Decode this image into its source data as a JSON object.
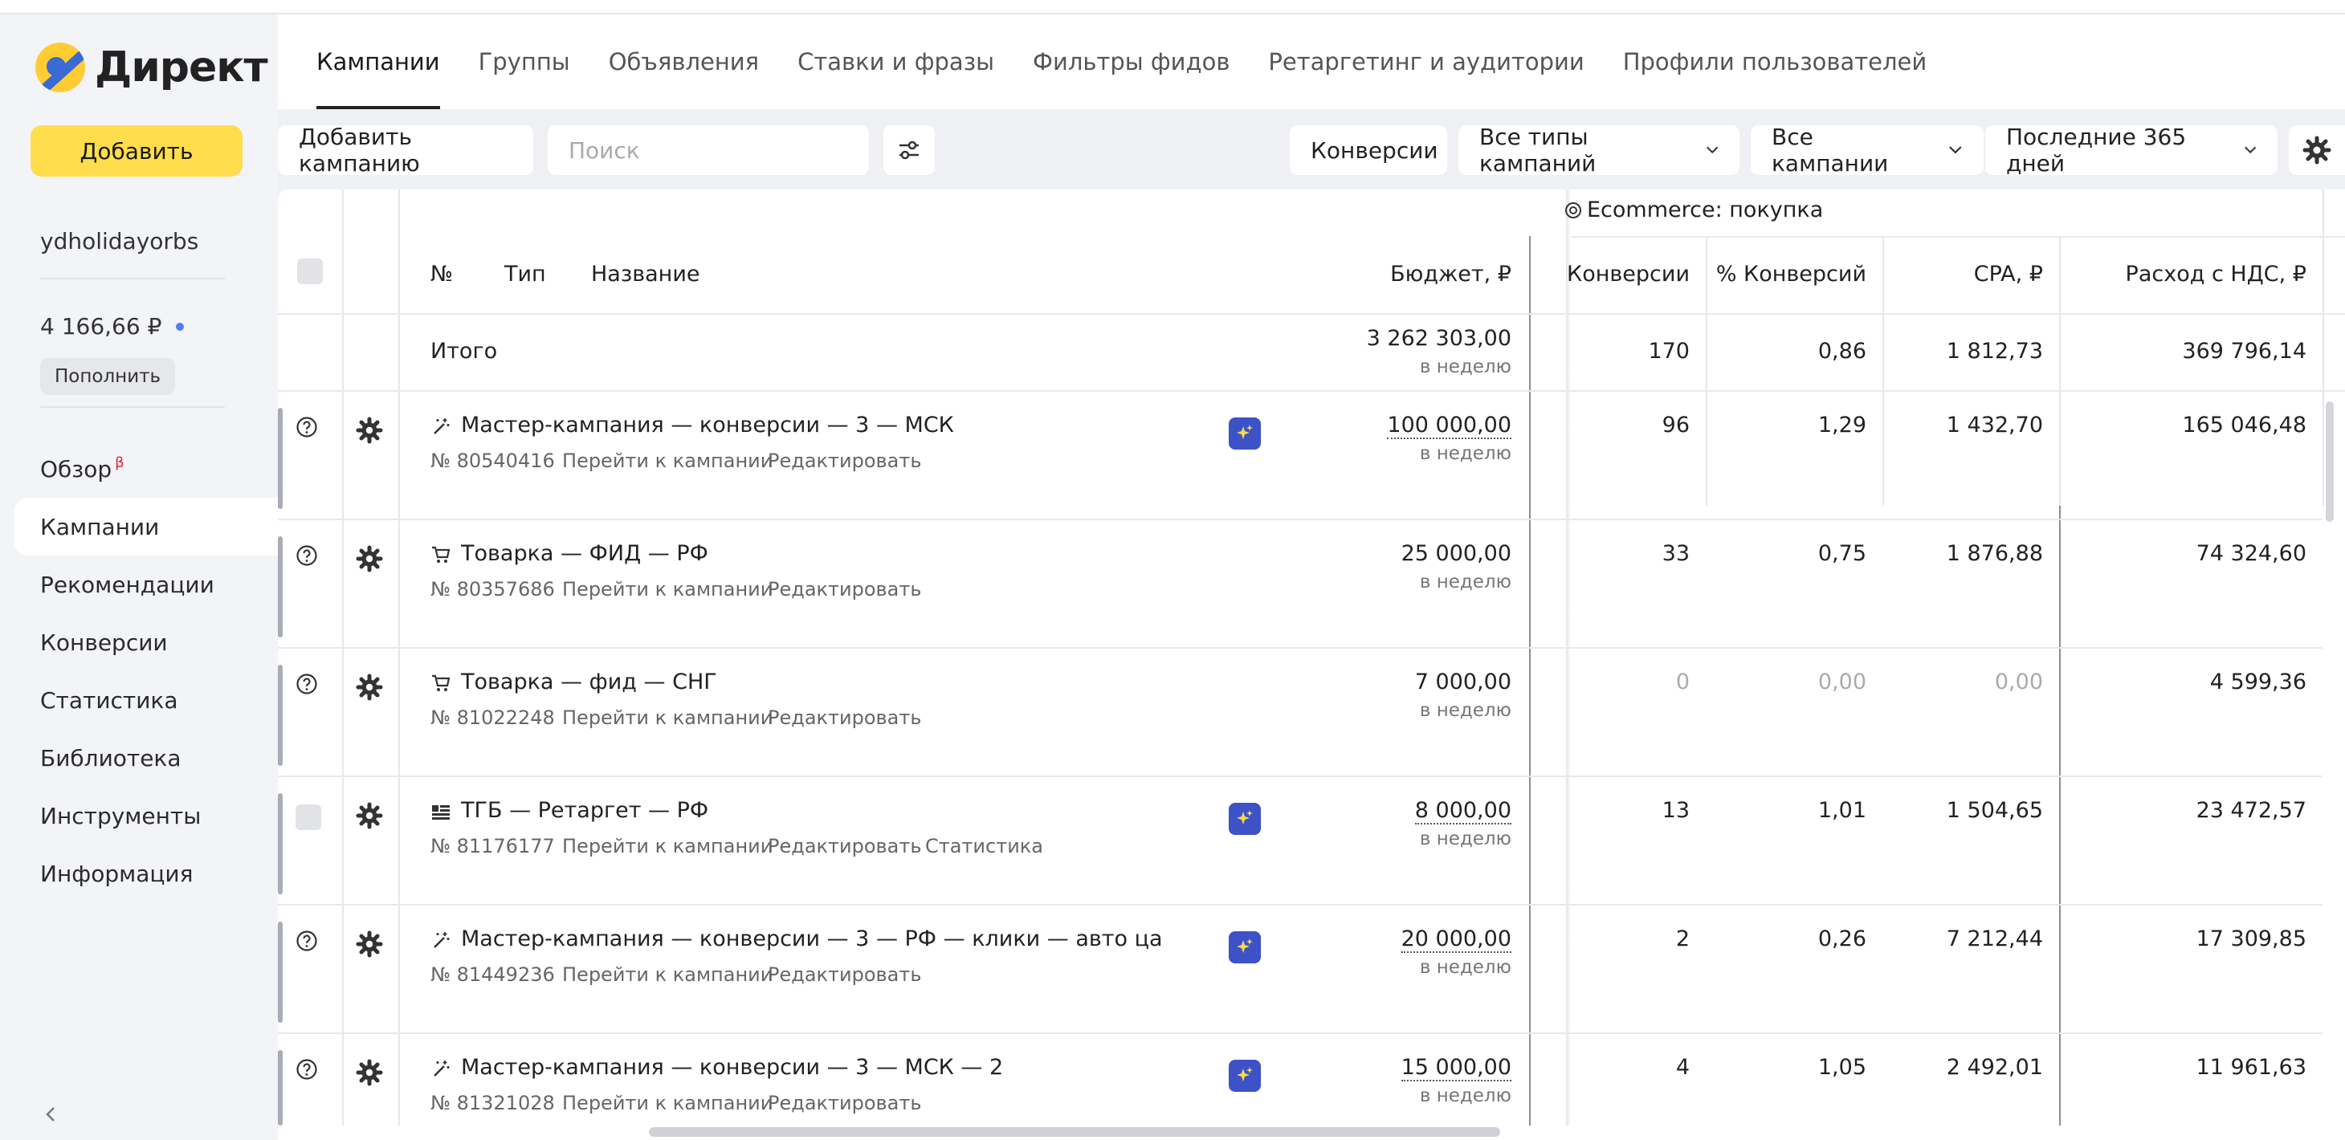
{
  "app": {
    "logo_text": "Директ"
  },
  "sidebar": {
    "add_button": "Добавить",
    "username": "ydholidayorbs",
    "balance": "4 166,66 ₽",
    "topup_button": "Пополнить",
    "nav": [
      {
        "label": "Обзор",
        "badge": "β"
      },
      {
        "label": "Кампании",
        "active": true
      },
      {
        "label": "Рекомендации"
      },
      {
        "label": "Конверсии"
      },
      {
        "label": "Статистика"
      },
      {
        "label": "Библиотека"
      },
      {
        "label": "Инструменты"
      },
      {
        "label": "Информация"
      }
    ]
  },
  "tabs": [
    "Кампании",
    "Группы",
    "Объявления",
    "Ставки и фразы",
    "Фильтры фидов",
    "Ретаргетинг и аудитории",
    "Профили пользователей"
  ],
  "toolbar": {
    "add_campaign": "Добавить кампанию",
    "search_placeholder": "Поиск",
    "conversions": "Конверсии",
    "campaign_types": "Все типы кампаний",
    "all_campaigns": "Все кампании",
    "period": "Последние 365 дней"
  },
  "table": {
    "goal_header": "Ecommerce: покупка",
    "columns": {
      "num": "№",
      "type": "Тип",
      "name": "Название",
      "budget": "Бюджет, ₽",
      "conversions": "Конверсии",
      "conv_rate": "% Конверсий",
      "cpa": "CPA, ₽",
      "spend": "Расход с НДС, ₽"
    },
    "total": {
      "label": "Итого",
      "budget": "3 262 303,00",
      "budget_period": "в неделю",
      "conversions": "170",
      "conv_rate": "0,86",
      "cpa": "1 812,73",
      "spend": "369 796,14"
    },
    "links": {
      "goto": "Перейти к кампании",
      "edit": "Редактировать",
      "stats": "Статистика"
    },
    "rows": [
      {
        "name": "Мастер-кампания — конверсии — 3 — МСК",
        "id": "№ 80540416",
        "budget": "100 000,00",
        "period": "в неделю",
        "conversions": "96",
        "conv_rate": "1,29",
        "cpa": "1 432,70",
        "spend": "165 046,48"
      },
      {
        "name": "Товарка — ФИД — РФ",
        "id": "№ 80357686",
        "budget": "25 000,00",
        "period": "в неделю",
        "conversions": "33",
        "conv_rate": "0,75",
        "cpa": "1 876,88",
        "spend": "74 324,60"
      },
      {
        "name": "Товарка — фид — СНГ",
        "id": "№ 81022248",
        "budget": "7 000,00",
        "period": "в неделю",
        "conversions": "0",
        "conv_rate": "0,00",
        "cpa": "0,00",
        "spend": "4 599,36"
      },
      {
        "name": "ТГБ — Ретаргет — РФ",
        "id": "№ 81176177",
        "budget": "8 000,00",
        "period": "в неделю",
        "conversions": "13",
        "conv_rate": "1,01",
        "cpa": "1 504,65",
        "spend": "23 472,57"
      },
      {
        "name": "Мастер-кампания — конверсии — 3 — РФ — клики — авто ца",
        "id": "№ 81449236",
        "budget": "20 000,00",
        "period": "в неделю",
        "conversions": "2",
        "conv_rate": "0,26",
        "cpa": "7 212,44",
        "spend": "17 309,85"
      },
      {
        "name": "Мастер-кампания — конверсии — 3 — МСК — 2",
        "id": "№ 81321028",
        "budget": "15 000,00",
        "period": "в неделю",
        "conversions": "4",
        "conv_rate": "1,05",
        "cpa": "2 492,01",
        "spend": "11 961,63"
      }
    ]
  },
  "colors": {
    "accent_yellow": "#ffdd4d",
    "badge_blue": "#3d52c6",
    "sidebar_bg": "#f3f4f7"
  }
}
